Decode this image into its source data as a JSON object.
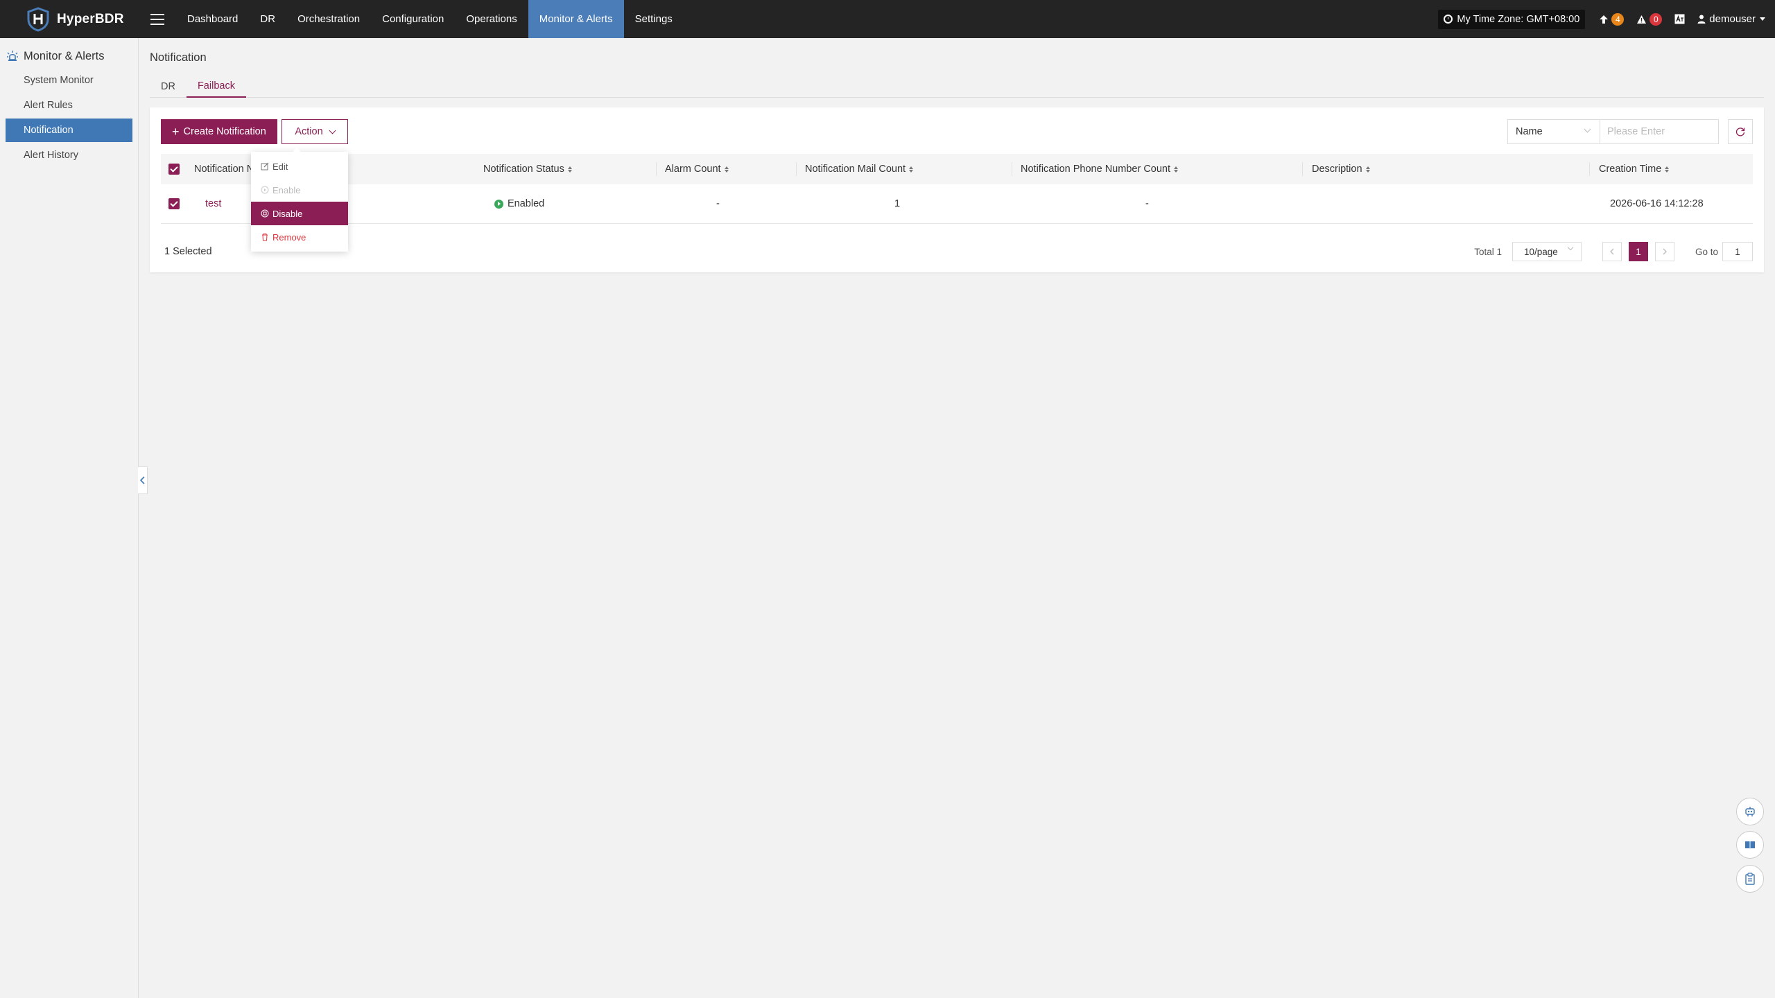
{
  "app": {
    "name": "HyperBDR"
  },
  "nav": {
    "items": [
      "Dashboard",
      "DR",
      "Orchestration",
      "Configuration",
      "Operations",
      "Monitor & Alerts",
      "Settings"
    ],
    "active": "Monitor & Alerts"
  },
  "header": {
    "timezone": "My Time Zone: GMT+08:00",
    "upgrade_count": "4",
    "alert_count": "0",
    "user": "demouser"
  },
  "sidebar": {
    "title": "Monitor & Alerts",
    "items": [
      "System Monitor",
      "Alert Rules",
      "Notification",
      "Alert History"
    ],
    "active": "Notification"
  },
  "page": {
    "title": "Notification",
    "tabs": [
      "DR",
      "Failback"
    ],
    "active_tab": "Failback"
  },
  "toolbar": {
    "create_label": "Create Notification",
    "action_label": "Action",
    "search_field": "Name",
    "search_placeholder": "Please Enter"
  },
  "action_menu": {
    "items": [
      "Edit",
      "Enable",
      "Disable",
      "Remove"
    ]
  },
  "table": {
    "columns": [
      "Notification Name",
      "Notification Status",
      "Alarm Count",
      "Notification Mail Count",
      "Notification Phone Number Count",
      "Description",
      "Creation Time"
    ],
    "column_visible": "Notification N",
    "rows": [
      {
        "name": "test",
        "status": "Enabled",
        "alarm_count": "-",
        "mail_count": "1",
        "phone_count": "-",
        "description": "",
        "created": "2026-06-16 14:12:28"
      }
    ]
  },
  "footer": {
    "selected": "1 Selected",
    "total": "Total 1",
    "page_size": "10/page",
    "current_page": "1",
    "goto_label": "Go to",
    "goto_value": "1"
  },
  "colors": {
    "brand": "#8b1e54",
    "nav_active": "#4b7db8",
    "status_enabled": "#3aa85a"
  }
}
